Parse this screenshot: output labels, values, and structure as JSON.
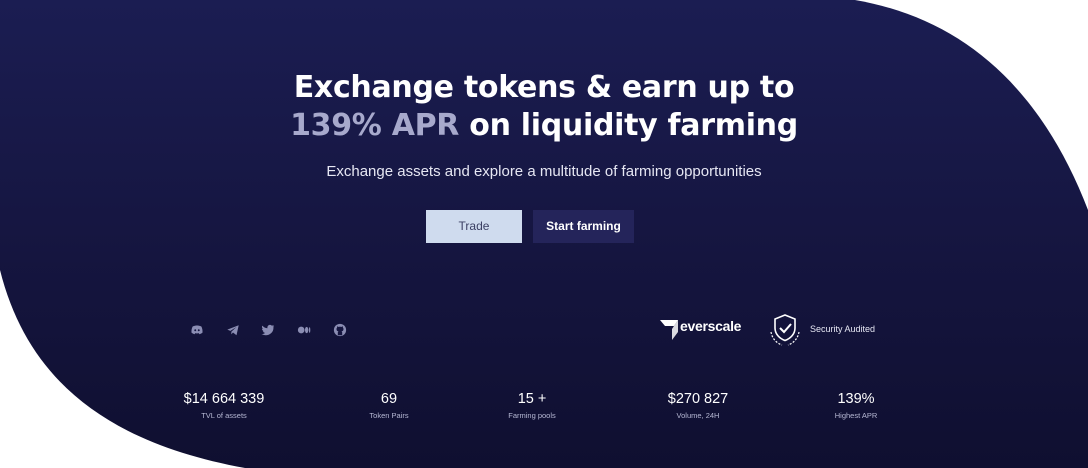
{
  "hero": {
    "title_line1": "Exchange tokens & earn up to",
    "title_accent": "139% APR",
    "title_line2_rest": " on liquidity farming",
    "subtitle": "Exchange assets and explore a multitude of farming opportunities"
  },
  "buttons": {
    "trade": "Trade",
    "start_farming": "Start farming"
  },
  "social_icons": [
    "discord-icon",
    "telegram-icon",
    "twitter-icon",
    "medium-icon",
    "github-icon"
  ],
  "partners": {
    "everscale": "everscale",
    "security": "Security Audited"
  },
  "stats": [
    {
      "value": "$14 664 339",
      "label": "TVL of assets"
    },
    {
      "value": "69",
      "label": "Token Pairs"
    },
    {
      "value": "15 +",
      "label": "Farming pools"
    },
    {
      "value": "$270 827",
      "label": "Volume, 24H"
    },
    {
      "value": "139%",
      "label": "Highest APR"
    }
  ],
  "colors": {
    "background_dark": "#131339",
    "accent_text": "#a7a9cc",
    "trade_button": "#cfdbee",
    "farm_button": "#24245a"
  }
}
